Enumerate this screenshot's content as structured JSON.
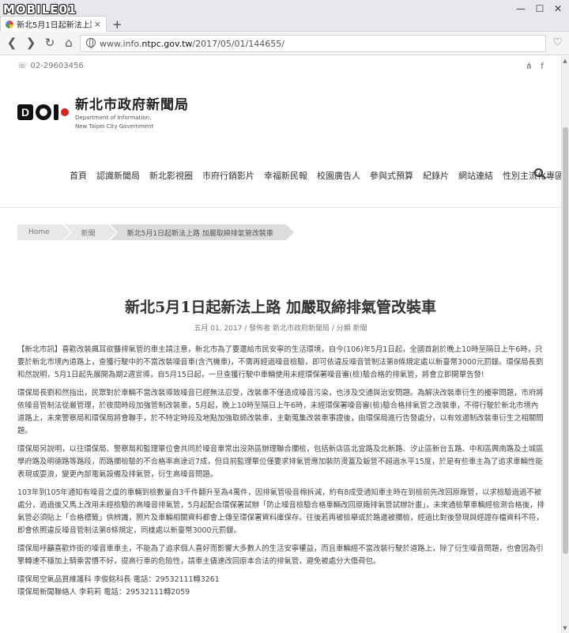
{
  "watermark": "MOBILE01",
  "browser": {
    "tab_title": "新北5月1日起新法上路 加",
    "tab_close": "×",
    "new_tab": "+",
    "url_prefix": "www.info.",
    "url_domain": "ntpc.gov.tw",
    "url_path": "/2017/05/01/144655/",
    "back": "❮",
    "forward": "❯",
    "reload": "↻",
    "home": "⌂",
    "minimize": "—",
    "maximize": "☐",
    "close": "✕",
    "favorite": "♡"
  },
  "header": {
    "phone": "02-29603456",
    "phone_icon": "phone-icon",
    "social": [
      "⋔",
      "f"
    ]
  },
  "logo": {
    "cn": "新北市政府新聞局",
    "en_line1": "Department of Information,",
    "en_line2": "New Taipei City Government"
  },
  "nav": {
    "items": [
      "首頁",
      "認識新聞局",
      "新北影視圈",
      "市府行銷影片",
      "幸福新民報",
      "校園廣告人",
      "參與式預算",
      "紀錄片",
      "網站連結",
      "性別主流化專區"
    ]
  },
  "breadcrumb": [
    "Home",
    "新聞",
    "新北5月1日起新法上路 加嚴取締排氣管改裝車"
  ],
  "article": {
    "title": "新北5月1日起新法上路 加嚴取締排氣管改裝車",
    "meta": "五月 01, 2017 / 發佈者 新北市政府新聞局 / 分類 新聞",
    "paragraphs": [
      "【新北市訊】喜歡改裝飆耳欲聾排氣管的車主請注意，新北市為了要還給市民安寧的生活環境，自今(106)年5月1日起，全國首創於晚上10時至隔日上午6時，只要於新北市境內道路上，查獲行駛中的不當改裝噪音車(含汽機車)，不需再經過噪音檢驗，即可依違反噪音管制法第8條規定處以新臺幣3000元罰鍰。環保局長劉和然說明，5月1日起先展開為期2週宣導，自5月15日起，一旦查獲行駛中車輛使用未經環保署噪音審(檢)驗合格的排氣管，將會立即開單告發!",
      "環保局長劉和然指出，民眾對於車輛不當改裝導致噪音已經無法忍受，改裝車不僅造成噪音污染，也涉及交通與治安問題。為解決改裝車衍生的擾寧問題，市府將依噪音管制法從嚴管理，於夜間時段加強管制改裝車，5月起，晚上10時至隔日上午6時，未經環保署噪音審(檢)驗合格排氣管之改裝車，不得行駛於新北市境內道路上，未來警察局和環保局將會聯手，於不特定時段及地點加強取締改裝車，主動蒐集改裝車事證後，由環保局進行告發處分，以有效遏制改裝車衍生之相關問題。",
      "環保局另說明，以往環保局、警察局和監理單位會共同於噪音車常出沒熱區辦理聯合攔檢，包括新店區北宜路及北新路、汐止區新台五路、中和區興南路及土城區學府路及明德路等路段，而路攔檢驗的不合格率高達近7成，但目前監理單位僅要求排氣管應加裝防燙蓋及鈑管不超過水平15度，於是有些車主為了追求車輛性能表現或耍浪，變更內部電氣設備及排氣管，衍生高噪音問題。",
      "103年到105年通知有噪音之虞的車輛到檢數量自3千件翻升至為4萬件，因排氣管吸音棉拆減，約有8成受通知車主時在到檢前先改回原廠管，以求檢驗過過不被處分，過過後又馬上改用未經檢驗的高噪音排氣管，5月起配合環保署試辦「防止噪音檢驗合格車輛改回原廠排氣管試辦計畫」，未來通檢單車輛經檢測合格後，排氣管必須貼上「合格標籤」供辨識，照片及車輛相關資料都會上傳至環保署資料庫保存。往後若再被檢舉或於路邊被攔檢，經過比對後發現與經證存檔資料不符，即會依照違反噪音管制法第8條規定，同樣處以新臺幣3000元罰鍰。",
      "環保局呼籲喜歡炸街的噪音車車主，不能為了追求個人喜好而影響大多數人的生活安寧權益，而且車輛經不當改裝行駛於道路上，除了衍生噪音問題，也會因為引擎轉速不穩加上騎乘習慣不好，提高行車的危險性，請車主儘速改回原本合法的排氣管，避免被處分大傷荷包。"
    ],
    "contacts": [
      "環保局空氣品質維護科 李俊銘科長 電話：29532111轉3261",
      "環保局新聞聯絡人 李莉莉 電話：29532111轉2059"
    ]
  }
}
